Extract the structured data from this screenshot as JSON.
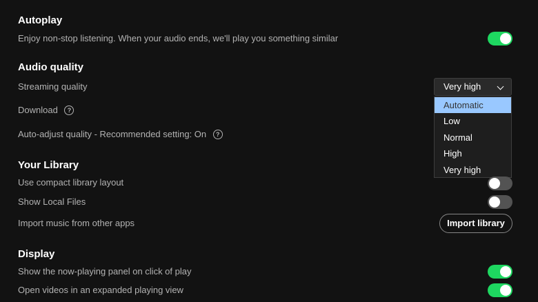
{
  "autoplay": {
    "heading": "Autoplay",
    "description": "Enjoy non-stop listening. When your audio ends, we'll play you something similar",
    "toggle_on": true
  },
  "audio_quality": {
    "heading": "Audio quality",
    "streaming_label": "Streaming quality",
    "streaming_value": "Very high",
    "download_label": "Download",
    "auto_adjust_label": "Auto-adjust quality - Recommended setting: On",
    "help_glyph": "?",
    "options": [
      "Automatic",
      "Low",
      "Normal",
      "High",
      "Very high"
    ],
    "highlighted_option": "Automatic"
  },
  "library": {
    "heading": "Your Library",
    "compact_label": "Use compact library layout",
    "compact_on": false,
    "local_files_label": "Show Local Files",
    "local_files_on": false,
    "import_label": "Import music from other apps",
    "import_button": "Import library"
  },
  "display": {
    "heading": "Display",
    "now_playing_label": "Show the now-playing panel on click of play",
    "now_playing_on": true,
    "videos_label": "Open videos in an expanded playing view",
    "videos_on": true
  },
  "colors": {
    "background": "#121212",
    "toggle_on": "#1ed760",
    "toggle_off": "#535353",
    "highlight": "#99c8ff"
  }
}
